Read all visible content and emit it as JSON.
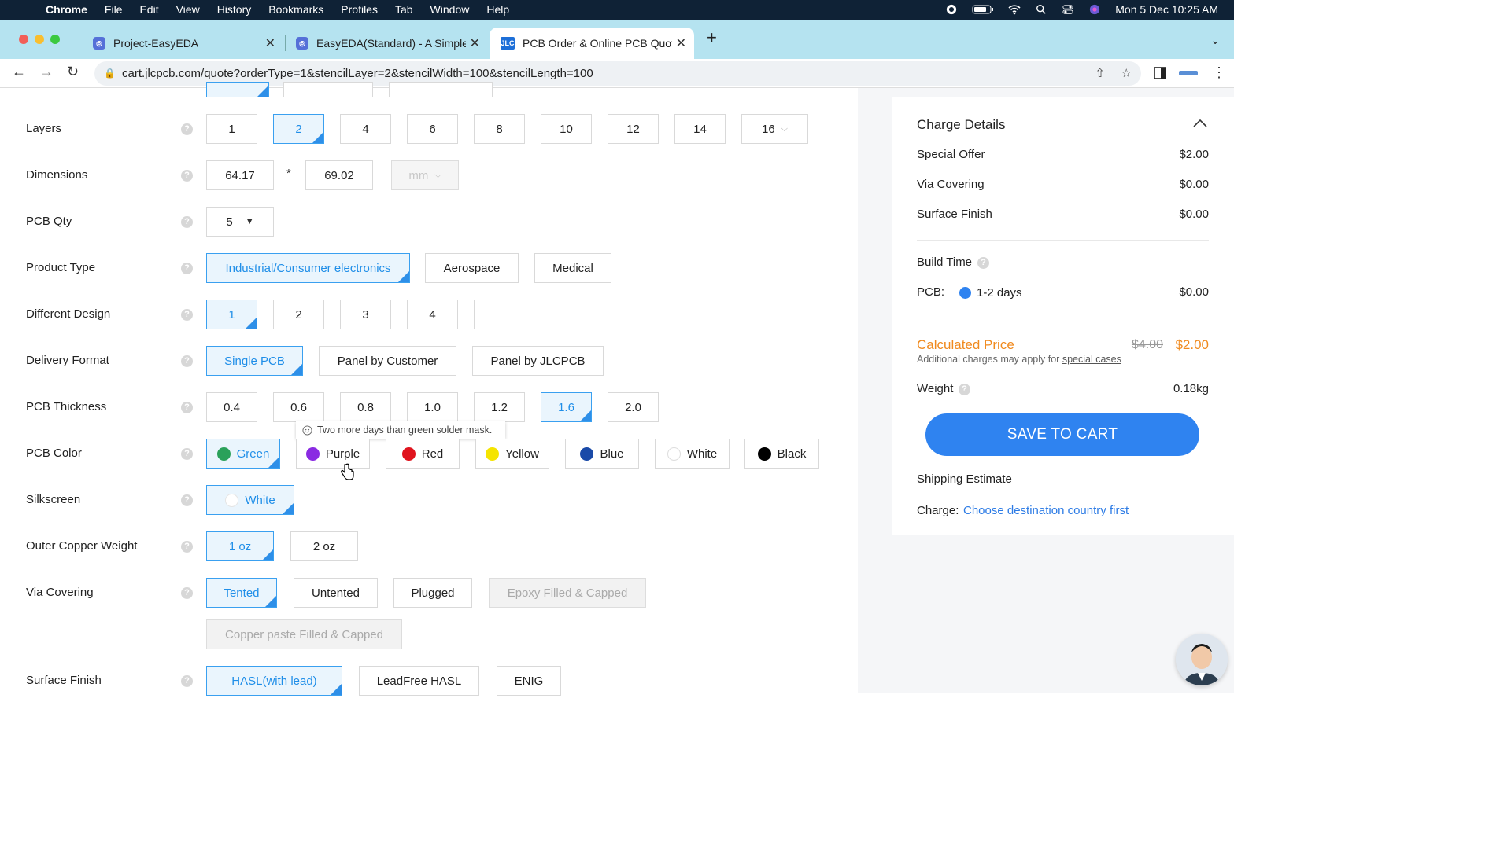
{
  "menubar": {
    "items": [
      "Chrome",
      "File",
      "Edit",
      "View",
      "History",
      "Bookmarks",
      "Profiles",
      "Tab",
      "Window",
      "Help"
    ],
    "datetime": "Mon 5 Dec  10:25 AM"
  },
  "tabs": [
    {
      "title": "Project-EasyEDA",
      "favicon": "easyeda-icon"
    },
    {
      "title": "EasyEDA(Standard) - A Simple",
      "favicon": "easyeda-icon"
    },
    {
      "title": "PCB Order & Online PCB Quote",
      "favicon": "jlc-icon",
      "favicon_text": "JLC"
    }
  ],
  "address": {
    "url": "cart.jlcpcb.com/quote?orderType=1&stencilLayer=2&stencilWidth=100&stencilLength=100"
  },
  "form": {
    "layers": {
      "label": "Layers",
      "options": [
        "1",
        "2",
        "4",
        "6",
        "8",
        "10",
        "12",
        "14",
        "16"
      ],
      "selected": "2"
    },
    "dimensions": {
      "label": "Dimensions",
      "width": "64.17",
      "sep": "*",
      "height": "69.02",
      "unit": "mm"
    },
    "qty": {
      "label": "PCB Qty",
      "value": "5"
    },
    "product_type": {
      "label": "Product Type",
      "options": [
        "Industrial/Consumer electronics",
        "Aerospace",
        "Medical"
      ],
      "selected": "Industrial/Consumer electronics"
    },
    "different_design": {
      "label": "Different Design",
      "options": [
        "1",
        "2",
        "3",
        "4",
        ""
      ],
      "selected": "1"
    },
    "delivery_format": {
      "label": "Delivery Format",
      "options": [
        "Single PCB",
        "Panel by Customer",
        "Panel by JLCPCB"
      ],
      "selected": "Single PCB"
    },
    "thickness": {
      "label": "PCB Thickness",
      "options": [
        "0.4",
        "0.6",
        "0.8",
        "1.0",
        "1.2",
        "1.6",
        "2.0"
      ],
      "selected": "1.6"
    },
    "tooltip": "Two more days than green solder mask.",
    "color": {
      "label": "PCB Color",
      "options": [
        {
          "name": "Green",
          "hex": "#2aa15a"
        },
        {
          "name": "Purple",
          "hex": "#8a2be2"
        },
        {
          "name": "Red",
          "hex": "#e0141e"
        },
        {
          "name": "Yellow",
          "hex": "#f5e400"
        },
        {
          "name": "Blue",
          "hex": "#1a4aa8"
        },
        {
          "name": "White",
          "hex": "#ffffff"
        },
        {
          "name": "Black",
          "hex": "#000000"
        }
      ],
      "selected": "Green"
    },
    "silkscreen": {
      "label": "Silkscreen",
      "value": "White"
    },
    "copper": {
      "label": "Outer Copper Weight",
      "options": [
        "1 oz",
        "2 oz"
      ],
      "selected": "1 oz"
    },
    "via": {
      "label": "Via Covering",
      "options": [
        "Tented",
        "Untented",
        "Plugged",
        "Epoxy Filled & Capped",
        "Copper paste Filled & Capped"
      ],
      "selected": "Tented"
    },
    "surface": {
      "label": "Surface Finish",
      "options": [
        "HASL(with lead)",
        "LeadFree HASL",
        "ENIG"
      ],
      "selected": "HASL(with lead)"
    }
  },
  "charge": {
    "title": "Charge Details",
    "special_offer": {
      "label": "Special Offer",
      "value": "$2.00"
    },
    "via_covering": {
      "label": "Via Covering",
      "value": "$0.00"
    },
    "surface_finish": {
      "label": "Surface Finish",
      "value": "$0.00"
    },
    "build_time": "Build Time",
    "pcb": {
      "label": "PCB:",
      "option": "1-2 days",
      "value": "$0.00"
    },
    "calculated": {
      "label": "Calculated Price",
      "old": "$4.00",
      "new": "$2.00",
      "note": "Additional charges may apply for",
      "note_link": "special cases"
    },
    "weight": {
      "label": "Weight",
      "value": "0.18kg"
    },
    "save_button": "SAVE TO CART",
    "shipping": "Shipping Estimate",
    "charge_label": "Charge:",
    "charge_link": "Choose destination country first"
  },
  "colors": {
    "accent": "#2f83f0",
    "orange": "#f08a1e",
    "link": "#2c7be5"
  }
}
